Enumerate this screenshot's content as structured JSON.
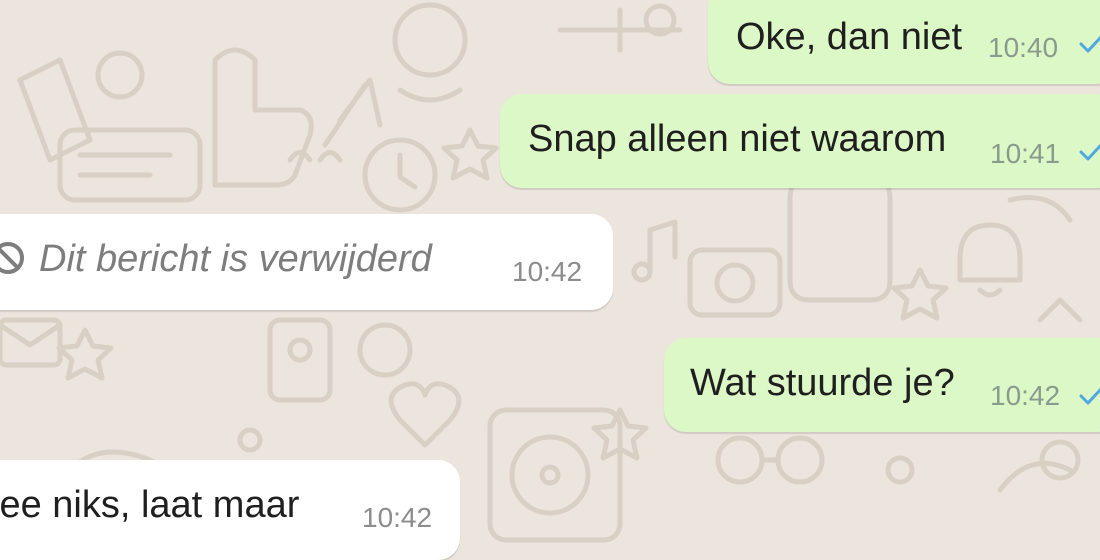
{
  "messages": [
    {
      "id": "m1",
      "direction": "outgoing",
      "text": "Oke, dan niet",
      "time": "10:40",
      "status": "sent"
    },
    {
      "id": "m2",
      "direction": "outgoing",
      "text": "Snap alleen niet waarom",
      "time": "10:41",
      "status": "sent"
    },
    {
      "id": "m3",
      "direction": "incoming",
      "text": "Dit bericht is verwijderd",
      "time": "10:42",
      "deleted": true,
      "icon": "ban-icon"
    },
    {
      "id": "m4",
      "direction": "outgoing",
      "text": "Wat stuurde je?",
      "time": "10:42",
      "status": "sent"
    },
    {
      "id": "m5",
      "direction": "incoming",
      "text": "Nee niks, laat maar",
      "time": "10:42"
    }
  ],
  "colors": {
    "wallpaper": "#ece5dd",
    "outgoing_bubble": "#dcf8c6",
    "incoming_bubble": "#ffffff",
    "tick": "#4fa8e0"
  },
  "icons": {
    "tick": "check-icon",
    "deleted": "ban-icon"
  }
}
